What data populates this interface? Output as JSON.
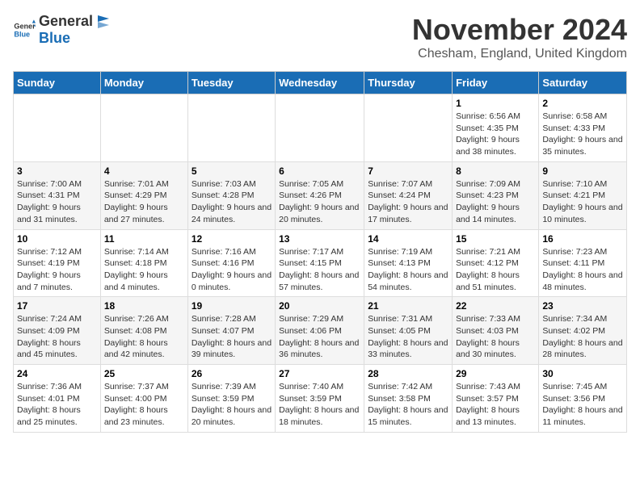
{
  "logo": {
    "text_general": "General",
    "text_blue": "Blue"
  },
  "title": {
    "month": "November 2024",
    "location": "Chesham, England, United Kingdom"
  },
  "weekdays": [
    "Sunday",
    "Monday",
    "Tuesday",
    "Wednesday",
    "Thursday",
    "Friday",
    "Saturday"
  ],
  "weeks": [
    [
      {
        "day": "",
        "info": ""
      },
      {
        "day": "",
        "info": ""
      },
      {
        "day": "",
        "info": ""
      },
      {
        "day": "",
        "info": ""
      },
      {
        "day": "",
        "info": ""
      },
      {
        "day": "1",
        "info": "Sunrise: 6:56 AM\nSunset: 4:35 PM\nDaylight: 9 hours and 38 minutes."
      },
      {
        "day": "2",
        "info": "Sunrise: 6:58 AM\nSunset: 4:33 PM\nDaylight: 9 hours and 35 minutes."
      }
    ],
    [
      {
        "day": "3",
        "info": "Sunrise: 7:00 AM\nSunset: 4:31 PM\nDaylight: 9 hours and 31 minutes."
      },
      {
        "day": "4",
        "info": "Sunrise: 7:01 AM\nSunset: 4:29 PM\nDaylight: 9 hours and 27 minutes."
      },
      {
        "day": "5",
        "info": "Sunrise: 7:03 AM\nSunset: 4:28 PM\nDaylight: 9 hours and 24 minutes."
      },
      {
        "day": "6",
        "info": "Sunrise: 7:05 AM\nSunset: 4:26 PM\nDaylight: 9 hours and 20 minutes."
      },
      {
        "day": "7",
        "info": "Sunrise: 7:07 AM\nSunset: 4:24 PM\nDaylight: 9 hours and 17 minutes."
      },
      {
        "day": "8",
        "info": "Sunrise: 7:09 AM\nSunset: 4:23 PM\nDaylight: 9 hours and 14 minutes."
      },
      {
        "day": "9",
        "info": "Sunrise: 7:10 AM\nSunset: 4:21 PM\nDaylight: 9 hours and 10 minutes."
      }
    ],
    [
      {
        "day": "10",
        "info": "Sunrise: 7:12 AM\nSunset: 4:19 PM\nDaylight: 9 hours and 7 minutes."
      },
      {
        "day": "11",
        "info": "Sunrise: 7:14 AM\nSunset: 4:18 PM\nDaylight: 9 hours and 4 minutes."
      },
      {
        "day": "12",
        "info": "Sunrise: 7:16 AM\nSunset: 4:16 PM\nDaylight: 9 hours and 0 minutes."
      },
      {
        "day": "13",
        "info": "Sunrise: 7:17 AM\nSunset: 4:15 PM\nDaylight: 8 hours and 57 minutes."
      },
      {
        "day": "14",
        "info": "Sunrise: 7:19 AM\nSunset: 4:13 PM\nDaylight: 8 hours and 54 minutes."
      },
      {
        "day": "15",
        "info": "Sunrise: 7:21 AM\nSunset: 4:12 PM\nDaylight: 8 hours and 51 minutes."
      },
      {
        "day": "16",
        "info": "Sunrise: 7:23 AM\nSunset: 4:11 PM\nDaylight: 8 hours and 48 minutes."
      }
    ],
    [
      {
        "day": "17",
        "info": "Sunrise: 7:24 AM\nSunset: 4:09 PM\nDaylight: 8 hours and 45 minutes."
      },
      {
        "day": "18",
        "info": "Sunrise: 7:26 AM\nSunset: 4:08 PM\nDaylight: 8 hours and 42 minutes."
      },
      {
        "day": "19",
        "info": "Sunrise: 7:28 AM\nSunset: 4:07 PM\nDaylight: 8 hours and 39 minutes."
      },
      {
        "day": "20",
        "info": "Sunrise: 7:29 AM\nSunset: 4:06 PM\nDaylight: 8 hours and 36 minutes."
      },
      {
        "day": "21",
        "info": "Sunrise: 7:31 AM\nSunset: 4:05 PM\nDaylight: 8 hours and 33 minutes."
      },
      {
        "day": "22",
        "info": "Sunrise: 7:33 AM\nSunset: 4:03 PM\nDaylight: 8 hours and 30 minutes."
      },
      {
        "day": "23",
        "info": "Sunrise: 7:34 AM\nSunset: 4:02 PM\nDaylight: 8 hours and 28 minutes."
      }
    ],
    [
      {
        "day": "24",
        "info": "Sunrise: 7:36 AM\nSunset: 4:01 PM\nDaylight: 8 hours and 25 minutes."
      },
      {
        "day": "25",
        "info": "Sunrise: 7:37 AM\nSunset: 4:00 PM\nDaylight: 8 hours and 23 minutes."
      },
      {
        "day": "26",
        "info": "Sunrise: 7:39 AM\nSunset: 3:59 PM\nDaylight: 8 hours and 20 minutes."
      },
      {
        "day": "27",
        "info": "Sunrise: 7:40 AM\nSunset: 3:59 PM\nDaylight: 8 hours and 18 minutes."
      },
      {
        "day": "28",
        "info": "Sunrise: 7:42 AM\nSunset: 3:58 PM\nDaylight: 8 hours and 15 minutes."
      },
      {
        "day": "29",
        "info": "Sunrise: 7:43 AM\nSunset: 3:57 PM\nDaylight: 8 hours and 13 minutes."
      },
      {
        "day": "30",
        "info": "Sunrise: 7:45 AM\nSunset: 3:56 PM\nDaylight: 8 hours and 11 minutes."
      }
    ]
  ]
}
